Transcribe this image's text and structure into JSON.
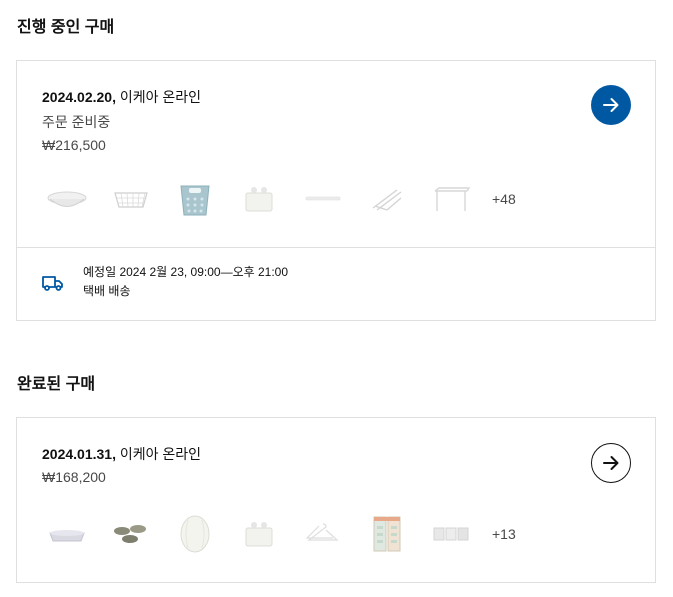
{
  "in_progress": {
    "section_title": "진행 중인 구매",
    "order": {
      "date": "2024.02.20,",
      "store": "이케아 온라인",
      "status": "주문 준비중",
      "price": "₩216,500",
      "thumbnails": [
        "round-bowl-icon",
        "wire-basket-icon",
        "laundry-basket-icon",
        "wall-container-icon",
        "wall-shelf-icon",
        "drying-rack-icon",
        "shelf-insert-icon"
      ],
      "more_count": "+48",
      "delivery": {
        "schedule": "예정일 2024 2월 23, 09:00—오후 21:00",
        "method": "택배 배송"
      }
    }
  },
  "completed": {
    "section_title": "완료된 구매",
    "order": {
      "date": "2024.01.31,",
      "store": "이케아 온라인",
      "price": "₩168,200",
      "thumbnails": [
        "soap-dish-icon",
        "coasters-icon",
        "lamp-shade-icon",
        "wall-container-icon",
        "hangers-icon",
        "storage-boxes-icon",
        "box-set-icon"
      ],
      "more_count": "+13"
    }
  },
  "colors": {
    "primary_button": "#0058a3",
    "border": "#dfdfdf",
    "text_secondary": "#484848"
  }
}
